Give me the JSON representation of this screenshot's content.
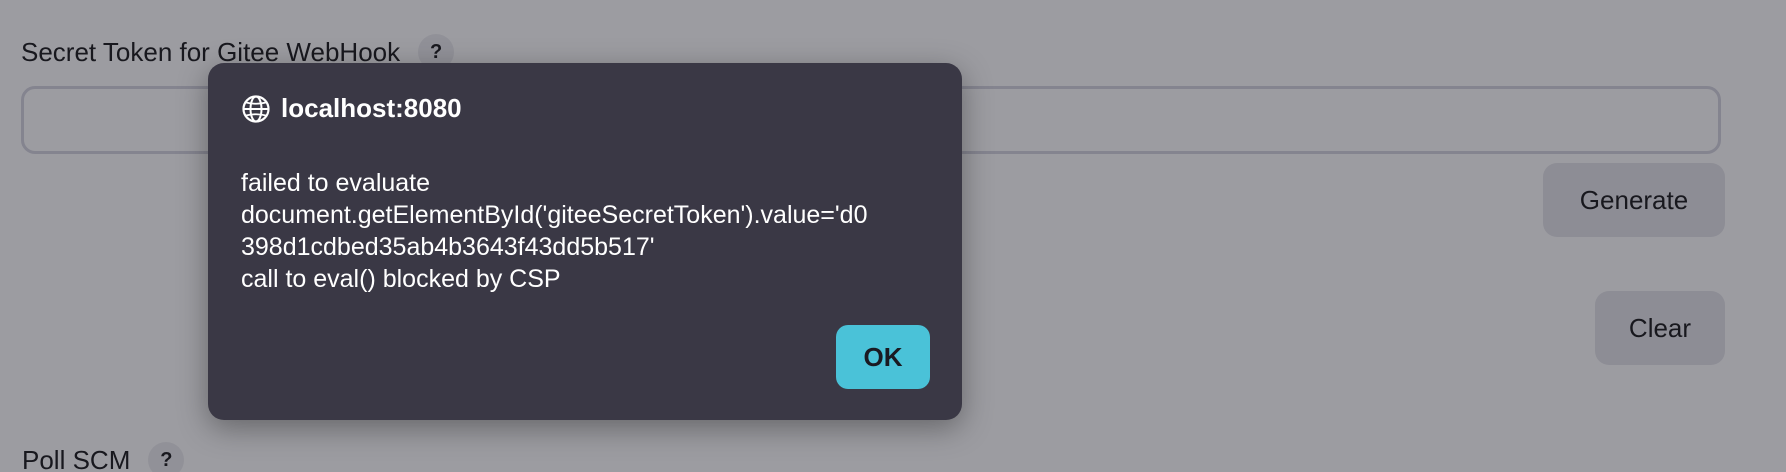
{
  "form": {
    "secret_token_label": "Secret Token for Gitee WebHook",
    "help_glyph": "?",
    "secret_token_value": "",
    "generate_label": "Generate",
    "clear_label": "Clear",
    "poll_scm_label": "Poll SCM"
  },
  "dialog": {
    "origin": "localhost:8080",
    "icon": "globe-icon",
    "message_lines": [
      "failed to evaluate",
      "document.getElementById('giteeSecretToken').value='d0",
      "398d1cdbed35ab4b3643f43dd5b517'",
      "call to eval() blocked by CSP"
    ],
    "ok_label": "OK"
  },
  "colors": {
    "dialog_bg": "#3a3845",
    "ok_button": "#4ac2d8"
  }
}
